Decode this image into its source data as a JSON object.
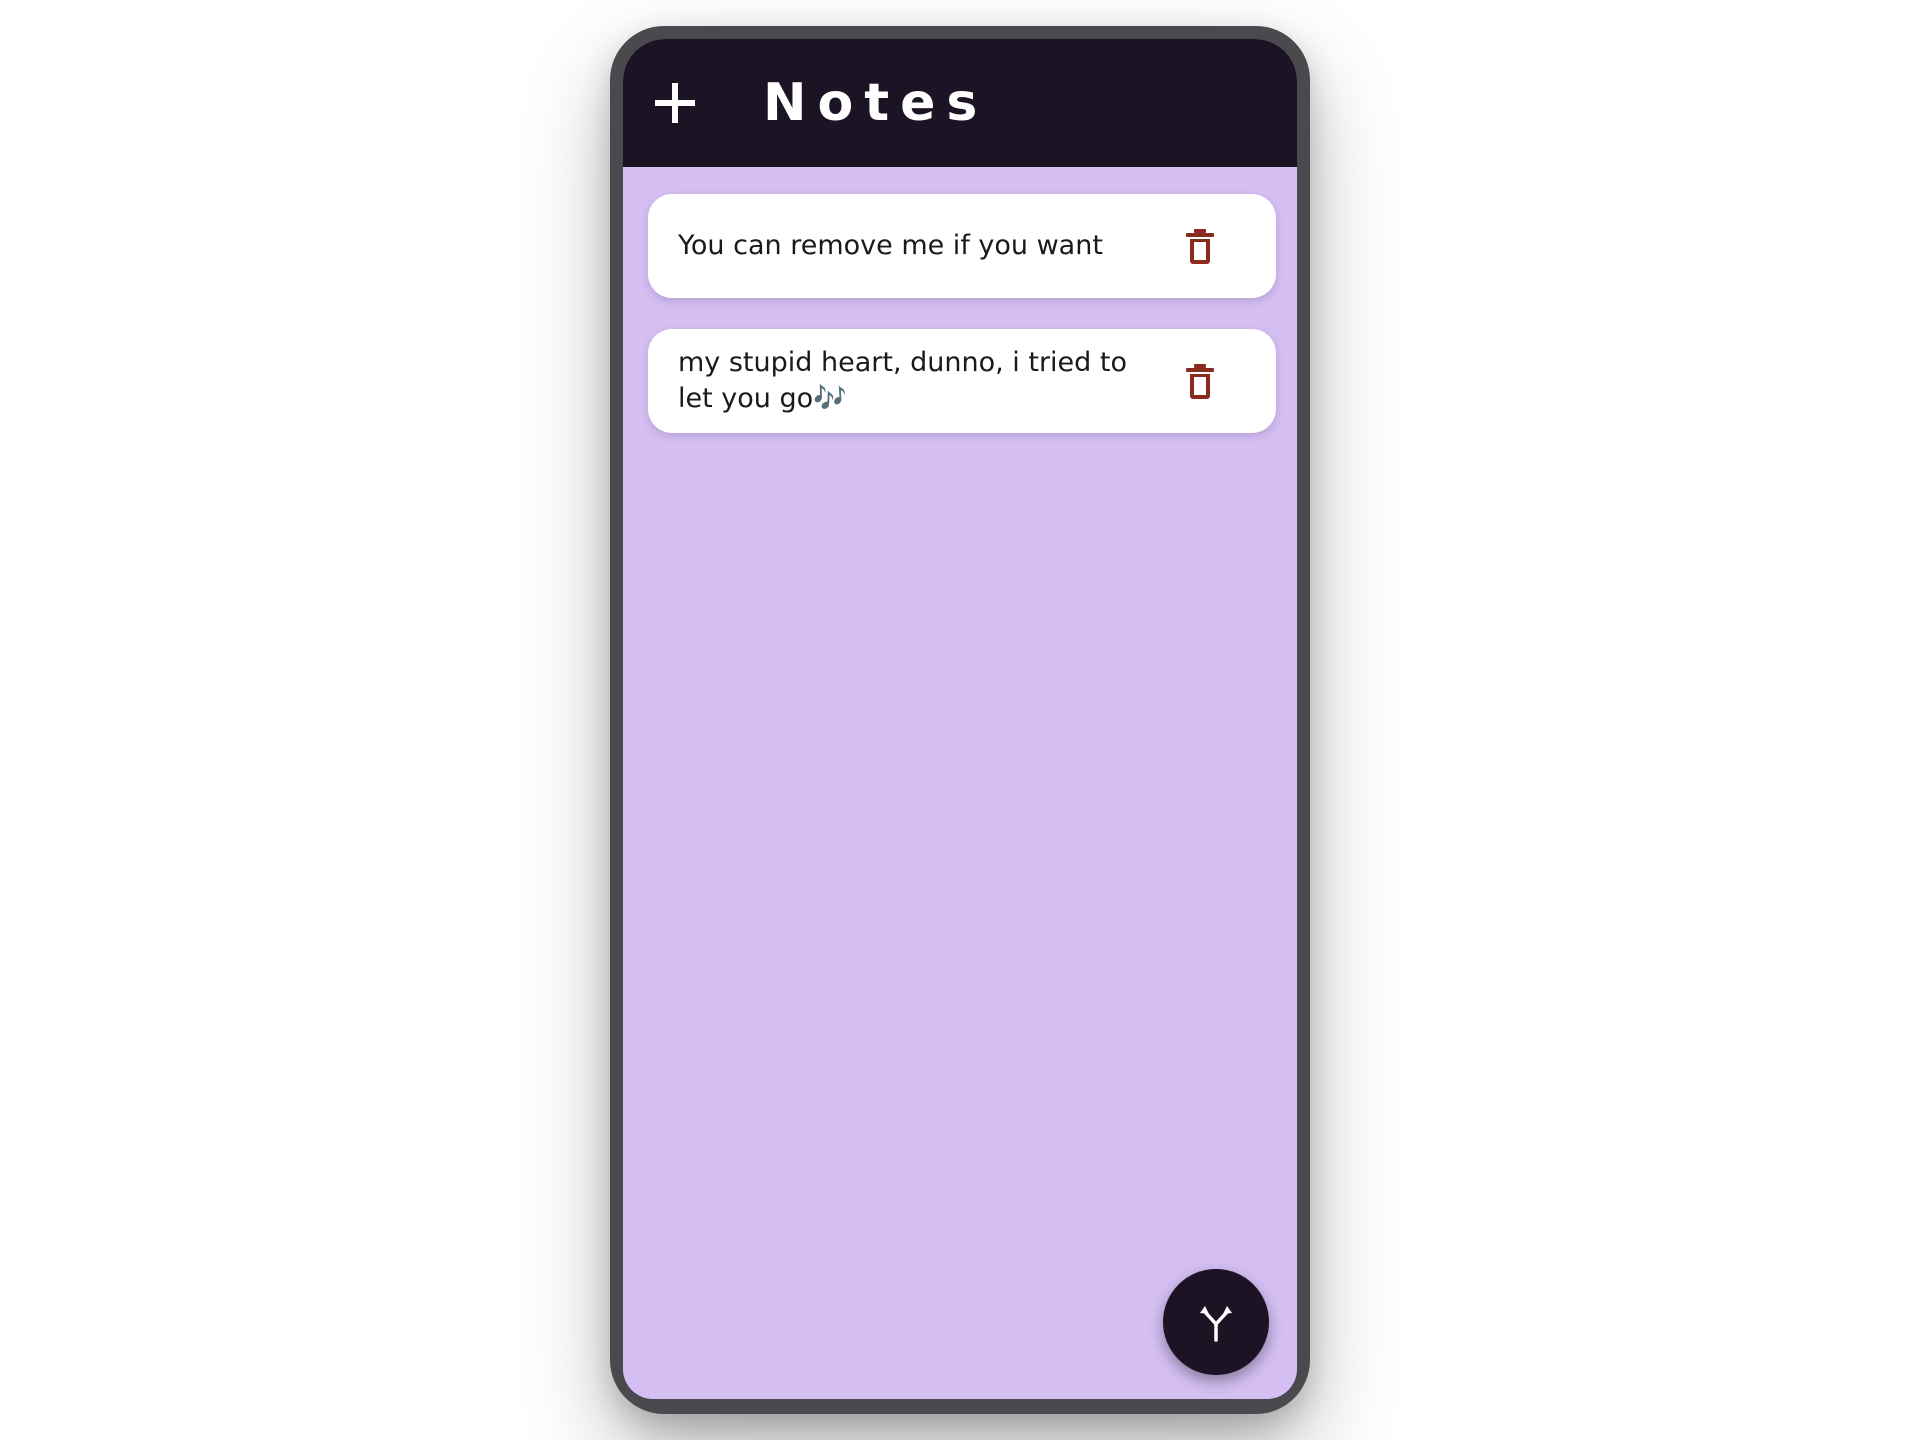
{
  "app_bar": {
    "title": "Notes",
    "add_icon": "plus-icon",
    "background_color": "#1c1425"
  },
  "notes": [
    {
      "text": "You can remove me if you want",
      "delete_icon": "trash-icon"
    },
    {
      "text": "my stupid heart, dunno, i tried to let you go🎶",
      "delete_icon": "trash-icon"
    }
  ],
  "fab": {
    "icon": "merge-arrows-icon"
  },
  "colors": {
    "screen_background": "#d4bef2",
    "card_background": "#ffffff",
    "delete_icon": "#8b2a1f",
    "frame": "#4a4a4e"
  }
}
